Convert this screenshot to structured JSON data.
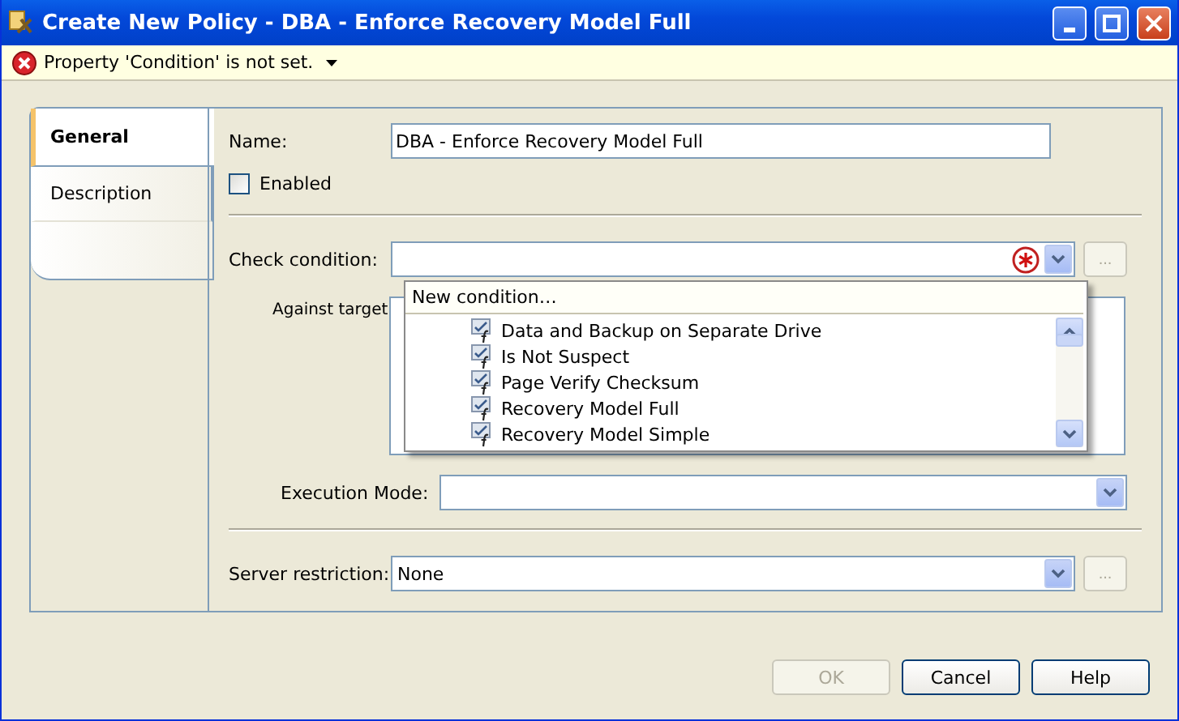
{
  "window": {
    "title": "Create New Policy - DBA - Enforce Recovery Model Full"
  },
  "info_bar": {
    "message": "Property 'Condition' is not set."
  },
  "tabs": [
    {
      "label": "General",
      "selected": true
    },
    {
      "label": "Description",
      "selected": false
    }
  ],
  "form": {
    "name": {
      "label": "Name:",
      "value": "DBA - Enforce Recovery Model Full"
    },
    "enabled": {
      "label": "Enabled",
      "checked": false
    },
    "check_condition": {
      "label": "Check condition:",
      "required": true,
      "browse": "...",
      "browse_disabled": true
    },
    "condition_dropdown": {
      "expanded": true,
      "new_item": "New condition…",
      "items": [
        "Data and Backup on Separate Drive",
        "Is Not Suspect",
        "Page Verify Checksum",
        "Recovery Model Full",
        "Recovery Model Simple"
      ]
    },
    "against_target": {
      "label": "Against target"
    },
    "execution_mode": {
      "label": "Execution Mode:"
    },
    "server_restriction": {
      "label": "Server restriction:",
      "value": "None",
      "browse": "...",
      "browse_disabled": true
    }
  },
  "buttons": [
    {
      "label": "OK",
      "disabled": true
    },
    {
      "label": "Cancel",
      "disabled": false
    },
    {
      "label": "Help",
      "disabled": false
    }
  ]
}
